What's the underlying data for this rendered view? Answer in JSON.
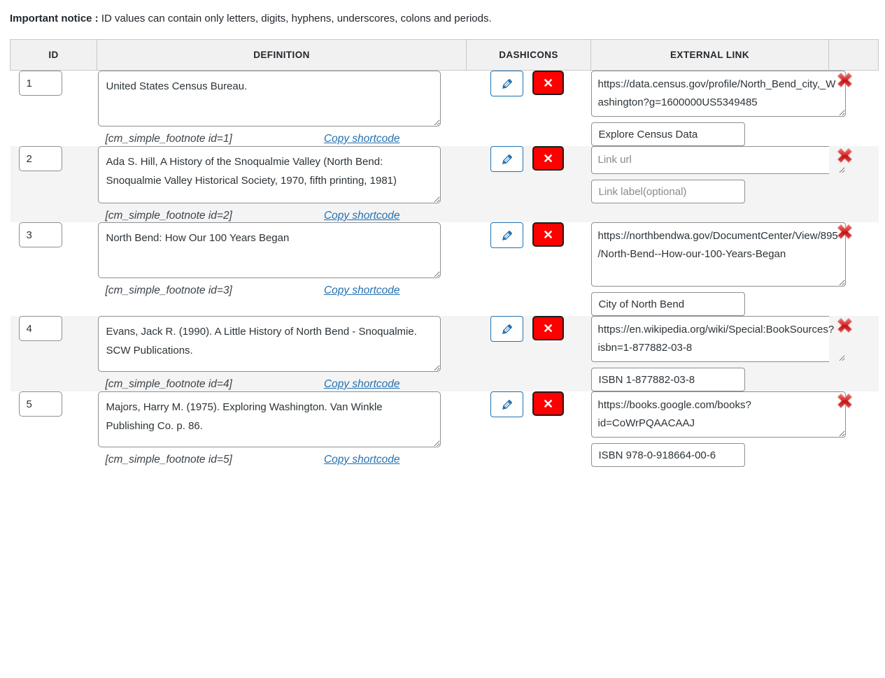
{
  "notice": {
    "label": "Important notice :",
    "text": " ID values can contain only letters, digits, hyphens, underscores, colons and periods."
  },
  "table": {
    "headers": {
      "id": "ID",
      "definition": "DEFINITION",
      "dashicons": "DASHICONS",
      "external_link": "EXTERNAL LINK",
      "delete": ""
    },
    "placeholders": {
      "link_url": "Link url",
      "link_label": "Link label(optional)"
    },
    "copy_label": "Copy shortcode",
    "icons": {
      "edit": "pencil-icon",
      "delete_small": "x-icon",
      "delete_row": "red-cross-icon"
    },
    "colors": {
      "header_bg": "#f1f1f1",
      "alt_row_bg": "#f4f4f4",
      "edit_border": "#2271b1",
      "delete_bg": "#ff0000",
      "link_color": "#2271b1"
    },
    "rows": [
      {
        "id": "1",
        "definition": "United States Census Bureau.",
        "shortcode": "[cm_simple_footnote id=1]",
        "link_url": "https://data.census.gov/profile/North_Bend_city,_Washington?g=1600000US5349485",
        "link_label": "Explore Census Data",
        "link_url_is_placeholder": false,
        "link_label_is_placeholder": false
      },
      {
        "id": "2",
        "definition": "Ada S. Hill, A History of the Snoqualmie Valley (North Bend: Snoqualmie Valley Historical Society, 1970, fifth printing, 1981)",
        "shortcode": "[cm_simple_footnote id=2]",
        "link_url": "",
        "link_label": "",
        "link_url_is_placeholder": true,
        "link_label_is_placeholder": true
      },
      {
        "id": "3",
        "definition": "North Bend: How Our 100 Years Began",
        "shortcode": "[cm_simple_footnote id=3]",
        "link_url": "https://northbendwa.gov/DocumentCenter/View/895/North-Bend--How-our-100-Years-Began",
        "link_label": "City of North Bend",
        "link_url_is_placeholder": false,
        "link_label_is_placeholder": false
      },
      {
        "id": "4",
        "definition": "Evans, Jack R. (1990). A Little History of North Bend - Snoqualmie. SCW Publications.",
        "shortcode": "[cm_simple_footnote id=4]",
        "link_url": "https://en.wikipedia.org/wiki/Special:BookSources?isbn=1-877882-03-8",
        "link_label": "ISBN 1-877882-03-8",
        "link_url_is_placeholder": false,
        "link_label_is_placeholder": false
      },
      {
        "id": "5",
        "definition": "Majors, Harry M. (1975). Exploring Washington. Van Winkle Publishing Co. p. 86.",
        "shortcode": "[cm_simple_footnote id=5]",
        "link_url": "https://books.google.com/books?id=CoWrPQAACAAJ",
        "link_label": "ISBN 978-0-918664-00-6",
        "link_url_is_placeholder": false,
        "link_label_is_placeholder": false
      }
    ]
  }
}
